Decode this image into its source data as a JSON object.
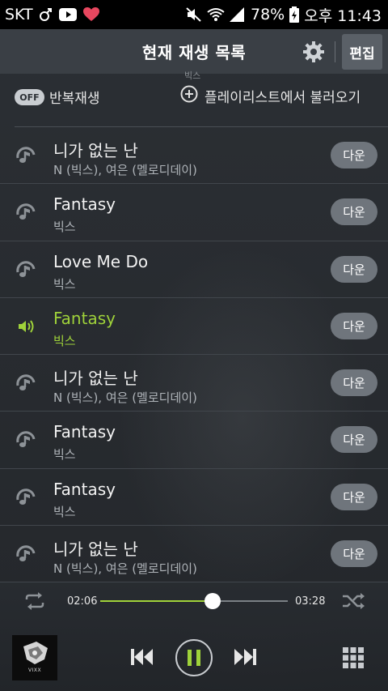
{
  "status_bar": {
    "carrier": "SKT",
    "battery": "78%",
    "time": "오후 11:43"
  },
  "header": {
    "title": "현재 재생 목록",
    "edit_label": "편집"
  },
  "subbar": {
    "peek_artist": "빅스",
    "repeat_toggle": "OFF",
    "repeat_label": "반복재생",
    "add_playlist_label": "플레이리스트에서 불러오기"
  },
  "tracks": [
    {
      "title": "니가 없는 난",
      "artist": "N (빅스), 여은 (멜로디데이)",
      "button": "다운",
      "playing": false
    },
    {
      "title": "Fantasy",
      "artist": "빅스",
      "button": "다운",
      "playing": false
    },
    {
      "title": "Love Me Do",
      "artist": "빅스",
      "button": "다운",
      "playing": false
    },
    {
      "title": "Fantasy",
      "artist": "빅스",
      "button": "다운",
      "playing": true
    },
    {
      "title": "니가 없는 난",
      "artist": "N (빅스), 여은 (멜로디데이)",
      "button": "다운",
      "playing": false
    },
    {
      "title": "Fantasy",
      "artist": "빅스",
      "button": "다운",
      "playing": false
    },
    {
      "title": "Fantasy",
      "artist": "빅스",
      "button": "다운",
      "playing": false
    },
    {
      "title": "니가 없는 난",
      "artist": "N (빅스), 여은 (멜로디데이)",
      "button": "다운",
      "playing": false
    }
  ],
  "player": {
    "current_time": "02:06",
    "total_time": "03:28",
    "progress": 0.6,
    "album_text": "VIXX",
    "icons": [
      "repeat-icon",
      "shuffle-icon",
      "previous-icon",
      "pause-icon",
      "next-icon",
      "grid-menu-icon"
    ]
  },
  "colors": {
    "accent": "#9fd23a",
    "header_bg": "#3a3f45",
    "button_bg": "#6f757c"
  }
}
